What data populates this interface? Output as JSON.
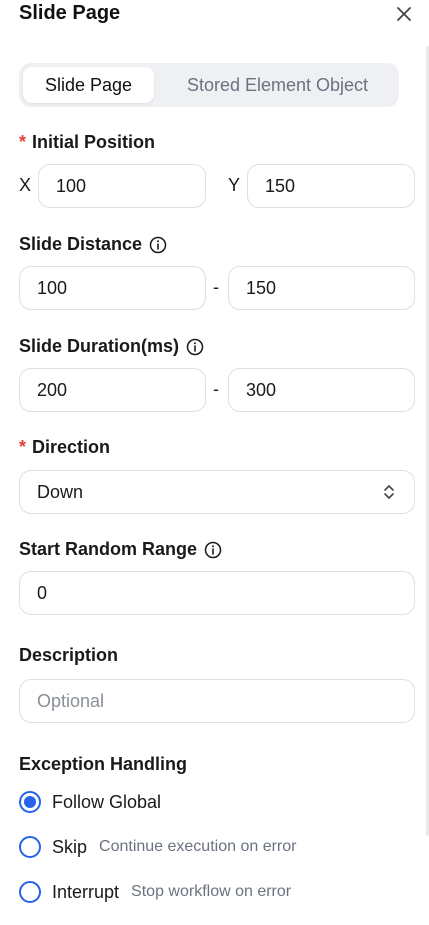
{
  "header": {
    "title": "Slide Page",
    "close_icon": "close-icon"
  },
  "tabs": [
    {
      "label": "Slide Page",
      "active": true
    },
    {
      "label": "Stored Element Object",
      "active": false
    }
  ],
  "initial_position": {
    "label": "Initial Position",
    "required_mark": "*",
    "x_label": "X",
    "x_value": "100",
    "y_label": "Y",
    "y_value": "150"
  },
  "slide_distance": {
    "label": "Slide Distance",
    "min": "100",
    "separator": "-",
    "max": "150",
    "icon": "info-icon"
  },
  "slide_duration": {
    "label": "Slide Duration(ms)",
    "min": "200",
    "separator": "-",
    "max": "300",
    "icon": "info-icon"
  },
  "direction": {
    "label": "Direction",
    "required_mark": "*",
    "value": "Down",
    "icon": "chevron-up-down-icon"
  },
  "start_random_range": {
    "label": "Start Random Range",
    "value": "0",
    "icon": "info-icon"
  },
  "description": {
    "label": "Description",
    "placeholder": "Optional",
    "value": ""
  },
  "exception_handling": {
    "label": "Exception Handling",
    "options": [
      {
        "label": "Follow Global",
        "hint": "",
        "checked": true
      },
      {
        "label": "Skip",
        "hint": "Continue execution on error",
        "checked": false
      },
      {
        "label": "Interrupt",
        "hint": "Stop workflow on error",
        "checked": false
      }
    ]
  },
  "colors": {
    "accent": "#2563eb",
    "required": "#e53e3e",
    "border": "#dcdfe4",
    "tab_bg": "#eef0f3"
  }
}
